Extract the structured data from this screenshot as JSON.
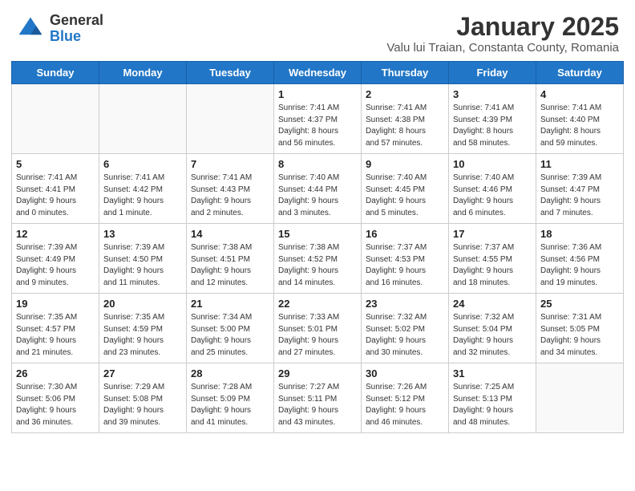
{
  "logo": {
    "general": "General",
    "blue": "Blue"
  },
  "title": "January 2025",
  "subtitle": "Valu lui Traian, Constanta County, Romania",
  "days_of_week": [
    "Sunday",
    "Monday",
    "Tuesday",
    "Wednesday",
    "Thursday",
    "Friday",
    "Saturday"
  ],
  "weeks": [
    [
      {
        "day": "",
        "info": ""
      },
      {
        "day": "",
        "info": ""
      },
      {
        "day": "",
        "info": ""
      },
      {
        "day": "1",
        "info": "Sunrise: 7:41 AM\nSunset: 4:37 PM\nDaylight: 8 hours\nand 56 minutes."
      },
      {
        "day": "2",
        "info": "Sunrise: 7:41 AM\nSunset: 4:38 PM\nDaylight: 8 hours\nand 57 minutes."
      },
      {
        "day": "3",
        "info": "Sunrise: 7:41 AM\nSunset: 4:39 PM\nDaylight: 8 hours\nand 58 minutes."
      },
      {
        "day": "4",
        "info": "Sunrise: 7:41 AM\nSunset: 4:40 PM\nDaylight: 8 hours\nand 59 minutes."
      }
    ],
    [
      {
        "day": "5",
        "info": "Sunrise: 7:41 AM\nSunset: 4:41 PM\nDaylight: 9 hours\nand 0 minutes."
      },
      {
        "day": "6",
        "info": "Sunrise: 7:41 AM\nSunset: 4:42 PM\nDaylight: 9 hours\nand 1 minute."
      },
      {
        "day": "7",
        "info": "Sunrise: 7:41 AM\nSunset: 4:43 PM\nDaylight: 9 hours\nand 2 minutes."
      },
      {
        "day": "8",
        "info": "Sunrise: 7:40 AM\nSunset: 4:44 PM\nDaylight: 9 hours\nand 3 minutes."
      },
      {
        "day": "9",
        "info": "Sunrise: 7:40 AM\nSunset: 4:45 PM\nDaylight: 9 hours\nand 5 minutes."
      },
      {
        "day": "10",
        "info": "Sunrise: 7:40 AM\nSunset: 4:46 PM\nDaylight: 9 hours\nand 6 minutes."
      },
      {
        "day": "11",
        "info": "Sunrise: 7:39 AM\nSunset: 4:47 PM\nDaylight: 9 hours\nand 7 minutes."
      }
    ],
    [
      {
        "day": "12",
        "info": "Sunrise: 7:39 AM\nSunset: 4:49 PM\nDaylight: 9 hours\nand 9 minutes."
      },
      {
        "day": "13",
        "info": "Sunrise: 7:39 AM\nSunset: 4:50 PM\nDaylight: 9 hours\nand 11 minutes."
      },
      {
        "day": "14",
        "info": "Sunrise: 7:38 AM\nSunset: 4:51 PM\nDaylight: 9 hours\nand 12 minutes."
      },
      {
        "day": "15",
        "info": "Sunrise: 7:38 AM\nSunset: 4:52 PM\nDaylight: 9 hours\nand 14 minutes."
      },
      {
        "day": "16",
        "info": "Sunrise: 7:37 AM\nSunset: 4:53 PM\nDaylight: 9 hours\nand 16 minutes."
      },
      {
        "day": "17",
        "info": "Sunrise: 7:37 AM\nSunset: 4:55 PM\nDaylight: 9 hours\nand 18 minutes."
      },
      {
        "day": "18",
        "info": "Sunrise: 7:36 AM\nSunset: 4:56 PM\nDaylight: 9 hours\nand 19 minutes."
      }
    ],
    [
      {
        "day": "19",
        "info": "Sunrise: 7:35 AM\nSunset: 4:57 PM\nDaylight: 9 hours\nand 21 minutes."
      },
      {
        "day": "20",
        "info": "Sunrise: 7:35 AM\nSunset: 4:59 PM\nDaylight: 9 hours\nand 23 minutes."
      },
      {
        "day": "21",
        "info": "Sunrise: 7:34 AM\nSunset: 5:00 PM\nDaylight: 9 hours\nand 25 minutes."
      },
      {
        "day": "22",
        "info": "Sunrise: 7:33 AM\nSunset: 5:01 PM\nDaylight: 9 hours\nand 27 minutes."
      },
      {
        "day": "23",
        "info": "Sunrise: 7:32 AM\nSunset: 5:02 PM\nDaylight: 9 hours\nand 30 minutes."
      },
      {
        "day": "24",
        "info": "Sunrise: 7:32 AM\nSunset: 5:04 PM\nDaylight: 9 hours\nand 32 minutes."
      },
      {
        "day": "25",
        "info": "Sunrise: 7:31 AM\nSunset: 5:05 PM\nDaylight: 9 hours\nand 34 minutes."
      }
    ],
    [
      {
        "day": "26",
        "info": "Sunrise: 7:30 AM\nSunset: 5:06 PM\nDaylight: 9 hours\nand 36 minutes."
      },
      {
        "day": "27",
        "info": "Sunrise: 7:29 AM\nSunset: 5:08 PM\nDaylight: 9 hours\nand 39 minutes."
      },
      {
        "day": "28",
        "info": "Sunrise: 7:28 AM\nSunset: 5:09 PM\nDaylight: 9 hours\nand 41 minutes."
      },
      {
        "day": "29",
        "info": "Sunrise: 7:27 AM\nSunset: 5:11 PM\nDaylight: 9 hours\nand 43 minutes."
      },
      {
        "day": "30",
        "info": "Sunrise: 7:26 AM\nSunset: 5:12 PM\nDaylight: 9 hours\nand 46 minutes."
      },
      {
        "day": "31",
        "info": "Sunrise: 7:25 AM\nSunset: 5:13 PM\nDaylight: 9 hours\nand 48 minutes."
      },
      {
        "day": "",
        "info": ""
      }
    ]
  ]
}
